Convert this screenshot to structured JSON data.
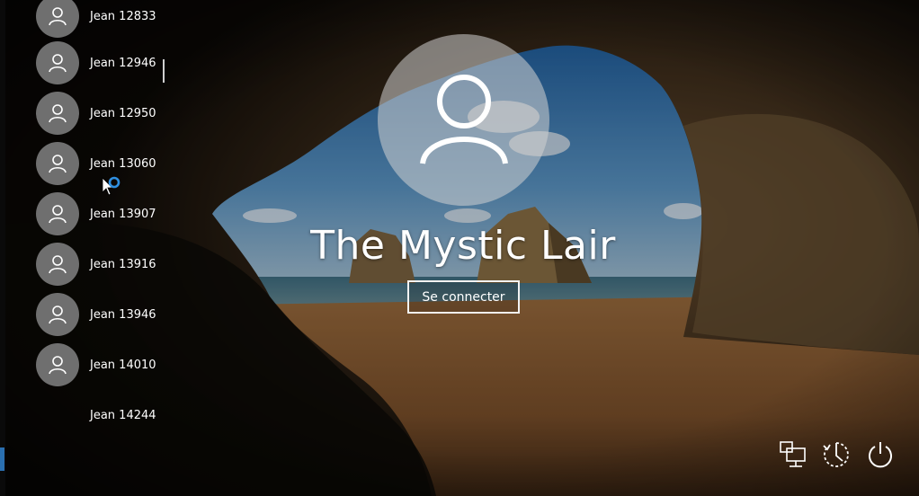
{
  "users": [
    {
      "name": "Jean 12833",
      "avatar": "user-icon"
    },
    {
      "name": "Jean 12946",
      "avatar": "user-icon"
    },
    {
      "name": "Jean 12950",
      "avatar": "user-icon"
    },
    {
      "name": "Jean 13060",
      "avatar": "user-icon"
    },
    {
      "name": "Jean 13907",
      "avatar": "user-icon"
    },
    {
      "name": "Jean 13916",
      "avatar": "user-icon"
    },
    {
      "name": "Jean 13946",
      "avatar": "user-icon"
    },
    {
      "name": "Jean 14010",
      "avatar": "user-icon"
    },
    {
      "name": "Jean 14244",
      "avatar": "none"
    }
  ],
  "login": {
    "machine_name": "The Mystic Lair",
    "signin_label": "Se connecter",
    "avatar_icon": "user-icon"
  },
  "system_buttons": [
    {
      "icon": "network-icon"
    },
    {
      "icon": "accessibility-icon"
    },
    {
      "icon": "power-icon"
    }
  ],
  "colors": {
    "avatar_small": "#6f6f6f",
    "text": "#ffffff",
    "sky": "#2f6fae",
    "sand": "#b07a45"
  }
}
